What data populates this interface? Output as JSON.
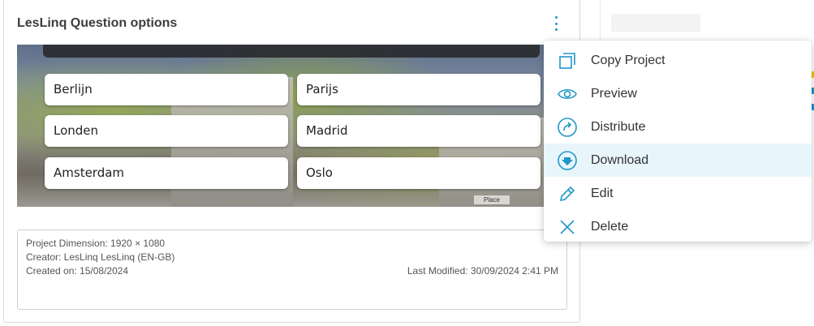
{
  "card": {
    "title": "LesLinq Question options"
  },
  "preview": {
    "answers": [
      "Berlijn",
      "Parijs",
      "Londen",
      "Madrid",
      "Amsterdam",
      "Oslo"
    ],
    "sign_text": "Place"
  },
  "info": {
    "dimension": "Project Dimension: 1920 × 1080",
    "creator": "Creator: LesLinq LesLinq (EN-GB)",
    "created": "Created on: 15/08/2024",
    "modified": "Last Modified: 30/09/2024 2:41 PM"
  },
  "menu": {
    "items": [
      {
        "label": "Copy Project",
        "icon": "copy-icon"
      },
      {
        "label": "Preview",
        "icon": "eye-icon"
      },
      {
        "label": "Distribute",
        "icon": "share-icon"
      },
      {
        "label": "Download",
        "icon": "download-icon",
        "highlighted": true
      },
      {
        "label": "Edit",
        "icon": "pencil-icon"
      },
      {
        "label": "Delete",
        "icon": "close-icon"
      }
    ]
  },
  "colors": {
    "accent": "#2196c9",
    "highlight": "#e8f6fc"
  }
}
